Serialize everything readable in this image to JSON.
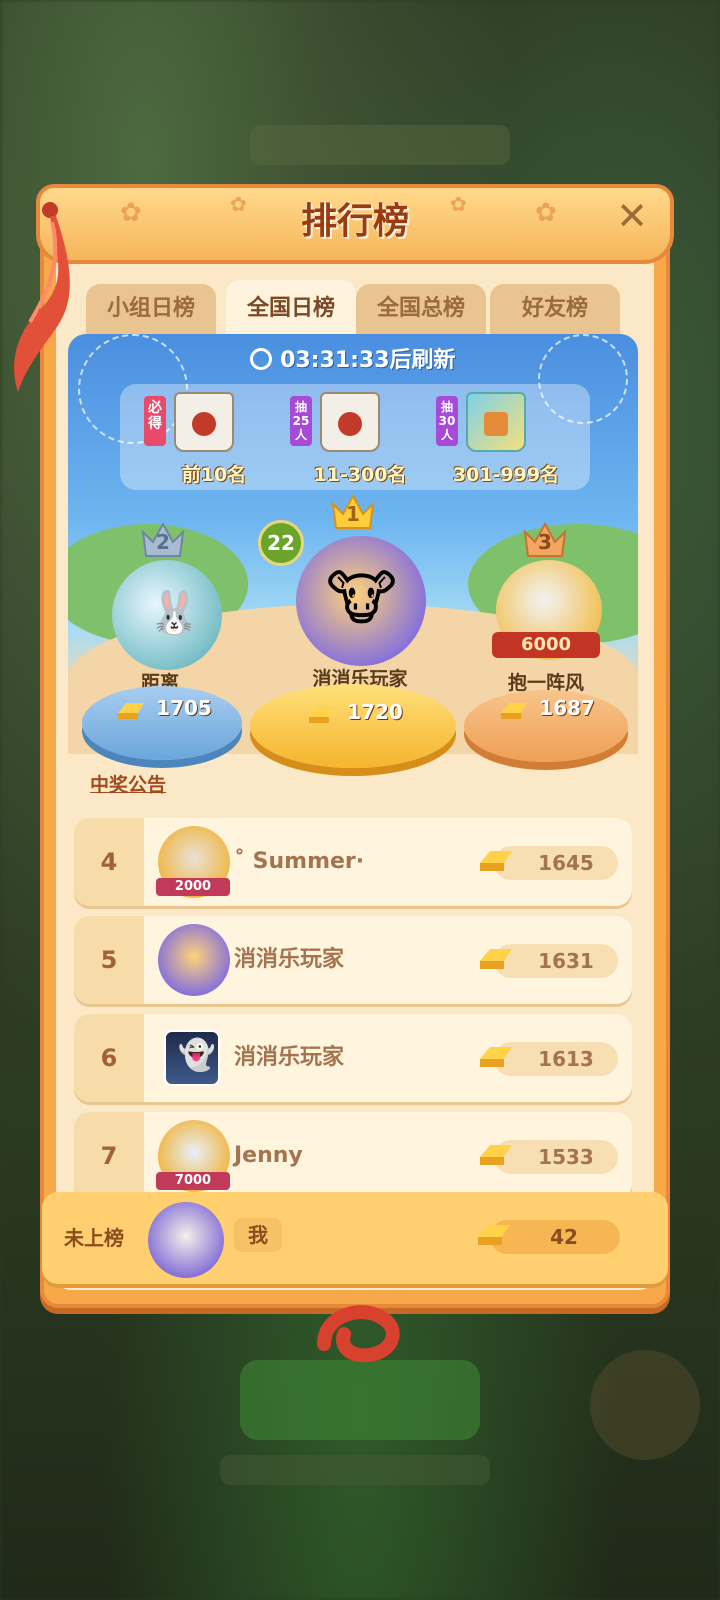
{
  "header": {
    "title": "排行榜"
  },
  "tabs": [
    {
      "label": "小组日榜",
      "active": false
    },
    {
      "label": "全国日榜",
      "active": true
    },
    {
      "label": "全国总榜",
      "active": false
    },
    {
      "label": "好友榜",
      "active": false
    }
  ],
  "banner": {
    "timer": "03:31:33",
    "timer_suffix": "后刷新",
    "prizes": [
      {
        "tag": "必得",
        "label": "前10名"
      },
      {
        "tag": "抽25人",
        "label": "11-300名"
      },
      {
        "tag": "抽30人",
        "label": "301-999名"
      }
    ]
  },
  "podium": [
    {
      "rank": "1",
      "name": "消消乐玩家",
      "score": "1720",
      "level": "22"
    },
    {
      "rank": "2",
      "name": "距离",
      "score": "1705"
    },
    {
      "rank": "3",
      "name": "抱一阵风",
      "score": "1687",
      "badge": "6000"
    }
  ],
  "announcement": "中奖公告",
  "rankings": [
    {
      "rank": "4",
      "name": "˚ Summer·",
      "score": "1645",
      "badge": "2000"
    },
    {
      "rank": "5",
      "name": "消消乐玩家",
      "score": "1631"
    },
    {
      "rank": "6",
      "name": "消消乐玩家",
      "score": "1613"
    },
    {
      "rank": "7",
      "name": "Jenny",
      "score": "1533",
      "badge": "7000"
    }
  ],
  "me": {
    "rank_label": "未上榜",
    "name": "我",
    "score": "42"
  },
  "colors": {
    "panel": "#f7a94a",
    "accent": "#9a3b12",
    "banner_sky": "#4a8ee0"
  },
  "icons": [
    "close-icon",
    "clock-icon",
    "gold-bar-icon",
    "crown-icon"
  ]
}
